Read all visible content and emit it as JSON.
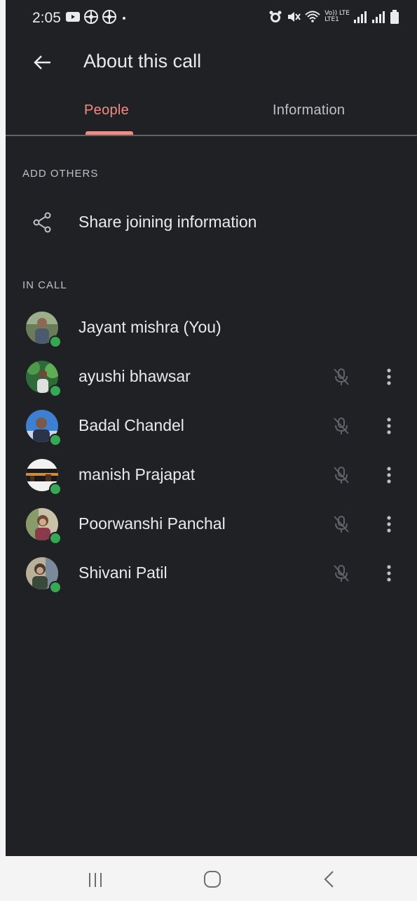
{
  "status_bar": {
    "time": "2:05",
    "network_label_top": "Vo)) LTE",
    "network_label_bottom": "LTE1"
  },
  "app_bar": {
    "title": "About this call"
  },
  "tabs": [
    {
      "label": "People",
      "selected": true
    },
    {
      "label": "Information",
      "selected": false
    }
  ],
  "add_others": {
    "header": "ADD OTHERS",
    "share_label": "Share joining information"
  },
  "in_call": {
    "header": "IN CALL",
    "participants": [
      {
        "name": "Jayant mishra (You)",
        "muted": false,
        "online": true
      },
      {
        "name": "ayushi bhawsar",
        "muted": true,
        "online": true
      },
      {
        "name": "Badal Chandel",
        "muted": true,
        "online": true
      },
      {
        "name": "manish Prajapat",
        "muted": true,
        "online": true
      },
      {
        "name": "Poorwanshi Panchal",
        "muted": true,
        "online": true
      },
      {
        "name": "Shivani Patil",
        "muted": true,
        "online": true
      }
    ]
  },
  "colors": {
    "background": "#202124",
    "accent": "#f28b82",
    "online": "#34a853",
    "navbar": "#f4f4f4"
  },
  "icons": {
    "back": "arrow-left-icon",
    "share": "share-icon",
    "mic_off": "mic-off-icon",
    "more": "more-vert-icon"
  }
}
